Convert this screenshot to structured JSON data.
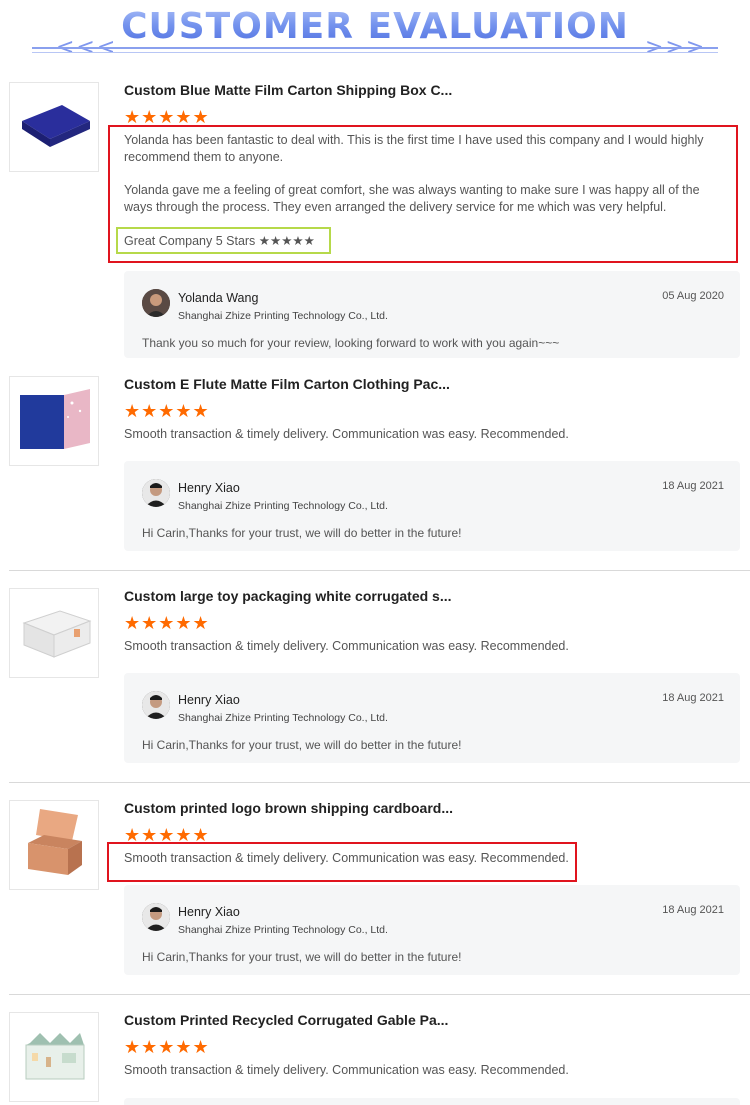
{
  "header": {
    "title": "CUSTOMER EVALUATION",
    "left_chevrons": "<<<",
    "right_chevrons": ">>>"
  },
  "reviews": [
    {
      "product_title": "Custom Blue Matte Film Carton Shipping Box C...",
      "stars": "★★★★★",
      "rating": 5,
      "text_p1": "Yolanda has been fantastic to deal with. This is the first time I have used this company and I would highly recommend them to anyone.",
      "text_p2": "Yolanda gave me a feeling of great comfort, she was always wanting to make sure I was happy all of the ways through the process. They even arranged the delivery service for me which was very helpful.",
      "tagline": "Great Company 5 Stars ★★★★★",
      "reply": {
        "name": "Yolanda Wang",
        "company": "Shanghai Zhize Printing Technology Co., Ltd.",
        "date": "05 Aug 2020",
        "message": "Thank you so much for your review,  looking forward to work with you again~~~"
      },
      "thumb_icon": "blue-box-icon"
    },
    {
      "product_title": "Custom E Flute Matte Film Carton Clothing Pac...",
      "stars": "★★★★★",
      "rating": 5,
      "text": "Smooth transaction & timely delivery. Communication was easy. Recommended.",
      "reply": {
        "name": "Henry Xiao",
        "company": "Shanghai Zhize Printing Technology Co., Ltd.",
        "date": "18 Aug 2021",
        "message": "Hi Carin,Thanks for your trust, we will do better in the future!"
      },
      "thumb_icon": "blue-pink-box-icon"
    },
    {
      "product_title": "Custom large toy packaging white corrugated s...",
      "stars": "★★★★★",
      "rating": 5,
      "text": "Smooth transaction & timely delivery. Communication was easy. Recommended.",
      "reply": {
        "name": "Henry Xiao",
        "company": "Shanghai Zhize Printing Technology Co., Ltd.",
        "date": "18 Aug 2021",
        "message": "Hi Carin,Thanks for your trust, we will do better in the future!"
      },
      "thumb_icon": "white-box-icon"
    },
    {
      "product_title": "Custom printed logo brown shipping cardboard...",
      "stars": "★★★★★",
      "rating": 5,
      "text": "Smooth transaction & timely delivery. Communication was easy. Recommended.",
      "reply": {
        "name": "Henry Xiao",
        "company": "Shanghai Zhize Printing Technology Co., Ltd.",
        "date": "18 Aug 2021",
        "message": "Hi Carin,Thanks for your trust, we will do better in the future!"
      },
      "thumb_icon": "brown-box-icon"
    },
    {
      "product_title": "Custom Printed Recycled Corrugated Gable Pa...",
      "stars": "★★★★★",
      "rating": 5,
      "text": "Smooth transaction & timely delivery. Communication was easy. Recommended.",
      "thumb_icon": "gable-box-icon"
    }
  ],
  "colors": {
    "star": "#ff6a00",
    "highlight_red": "#e0141e",
    "highlight_green": "#b6d94a",
    "title_blue": "#6f8ef0"
  }
}
